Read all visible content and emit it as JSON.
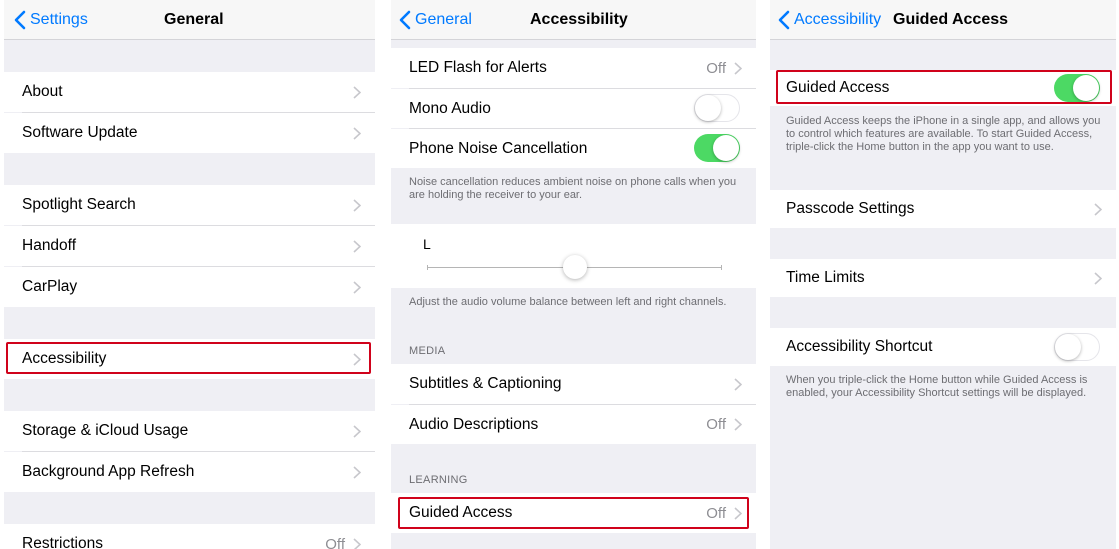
{
  "panel_general": {
    "back_label": "Settings",
    "title": "General",
    "rows": [
      {
        "label": "About"
      },
      {
        "label": "Software Update"
      },
      {
        "label": "Spotlight Search"
      },
      {
        "label": "Handoff"
      },
      {
        "label": "CarPlay"
      },
      {
        "label": "Accessibility"
      },
      {
        "label": "Storage & iCloud Usage"
      },
      {
        "label": "Background App Refresh"
      },
      {
        "label": "Restrictions",
        "value": "Off"
      }
    ]
  },
  "panel_accessibility": {
    "back_label": "General",
    "title": "Accessibility",
    "led_flash": {
      "label": "LED Flash for Alerts",
      "value": "Off"
    },
    "mono_audio": {
      "label": "Mono Audio",
      "toggle": "off"
    },
    "phone_noise": {
      "label": "Phone Noise Cancellation",
      "toggle": "on"
    },
    "noise_footnote": "Noise cancellation reduces ambient noise on phone calls when you are holding the receiver to your ear.",
    "balance": {
      "left_label": "L",
      "value": 0.5
    },
    "balance_footnote": "Adjust the audio volume balance between left and right channels.",
    "media_header": "MEDIA",
    "subtitles": {
      "label": "Subtitles & Captioning"
    },
    "audio_desc": {
      "label": "Audio Descriptions",
      "value": "Off"
    },
    "learning_header": "LEARNING",
    "guided_access": {
      "label": "Guided Access",
      "value": "Off"
    }
  },
  "panel_guided": {
    "back_label": "Accessibility",
    "title": "Guided Access",
    "guided_access": {
      "label": "Guided Access",
      "toggle": "on"
    },
    "guided_footnote": "Guided Access keeps the iPhone in a single app, and allows you to control which features are available. To start Guided Access, triple-click the Home button in the app you want to use.",
    "passcode": {
      "label": "Passcode Settings"
    },
    "time_limits": {
      "label": "Time Limits"
    },
    "shortcut": {
      "label": "Accessibility Shortcut",
      "toggle": "off"
    },
    "shortcut_footnote": "When you triple-click the Home button while Guided Access is enabled, your Accessibility Shortcut settings will be displayed."
  },
  "colors": {
    "accent": "#007aff",
    "toggle_on": "#4cd964",
    "highlight": "#d0021b"
  }
}
